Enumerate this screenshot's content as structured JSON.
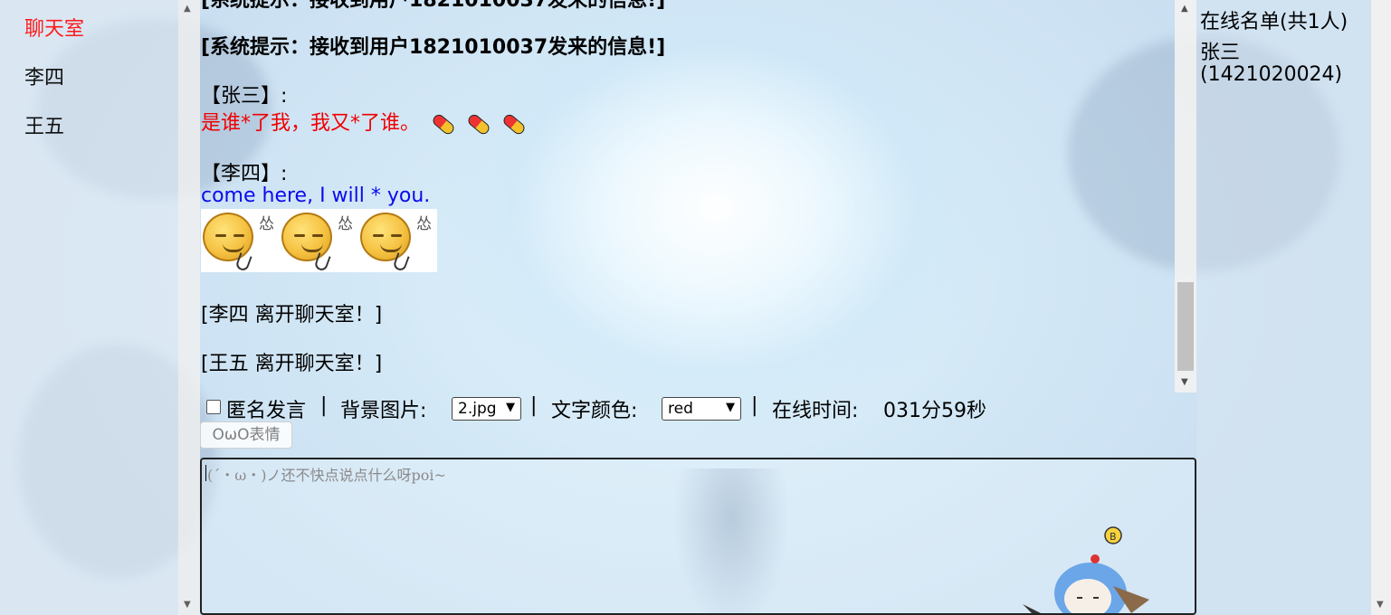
{
  "left_nav": {
    "items": [
      {
        "label": "聊天室",
        "active": true
      },
      {
        "label": "李四",
        "active": false
      },
      {
        "label": "王五",
        "active": false
      }
    ]
  },
  "messages": {
    "sys_recv": "[系统提示：接收到用户1821010037发来的信息!]",
    "msg1_sender": "【张三】:",
    "msg1_text": "是谁*了我，我又*了谁。",
    "msg1_icon": "pill-icon",
    "msg2_sender": "【李四】:",
    "msg2_text": "come here, I will * you.",
    "msg2_icon": "angry-face-emoji",
    "leave1": "[李四 离开聊天室！]",
    "leave2": "[王五 离开聊天室！]"
  },
  "online": {
    "title": "在线名单(共1人)",
    "user_name": "张三",
    "user_id": "(1421020024)"
  },
  "controls": {
    "anon_label": "匿名发言",
    "sep": "|",
    "bg_label": "背景图片:",
    "bg_value": "2.jpg",
    "color_label": "文字颜色:",
    "color_value": "red",
    "time_label": "在线时间:",
    "time_value": "031分59秒"
  },
  "owo_button": "OωO表情",
  "input": {
    "placeholder": "(´・ω・)ノ还不快点说点什么呀poi~"
  },
  "colors": {
    "active_nav": "#ff1a1a",
    "msg_red": "#f00000",
    "msg_blue": "#0a0aee"
  }
}
